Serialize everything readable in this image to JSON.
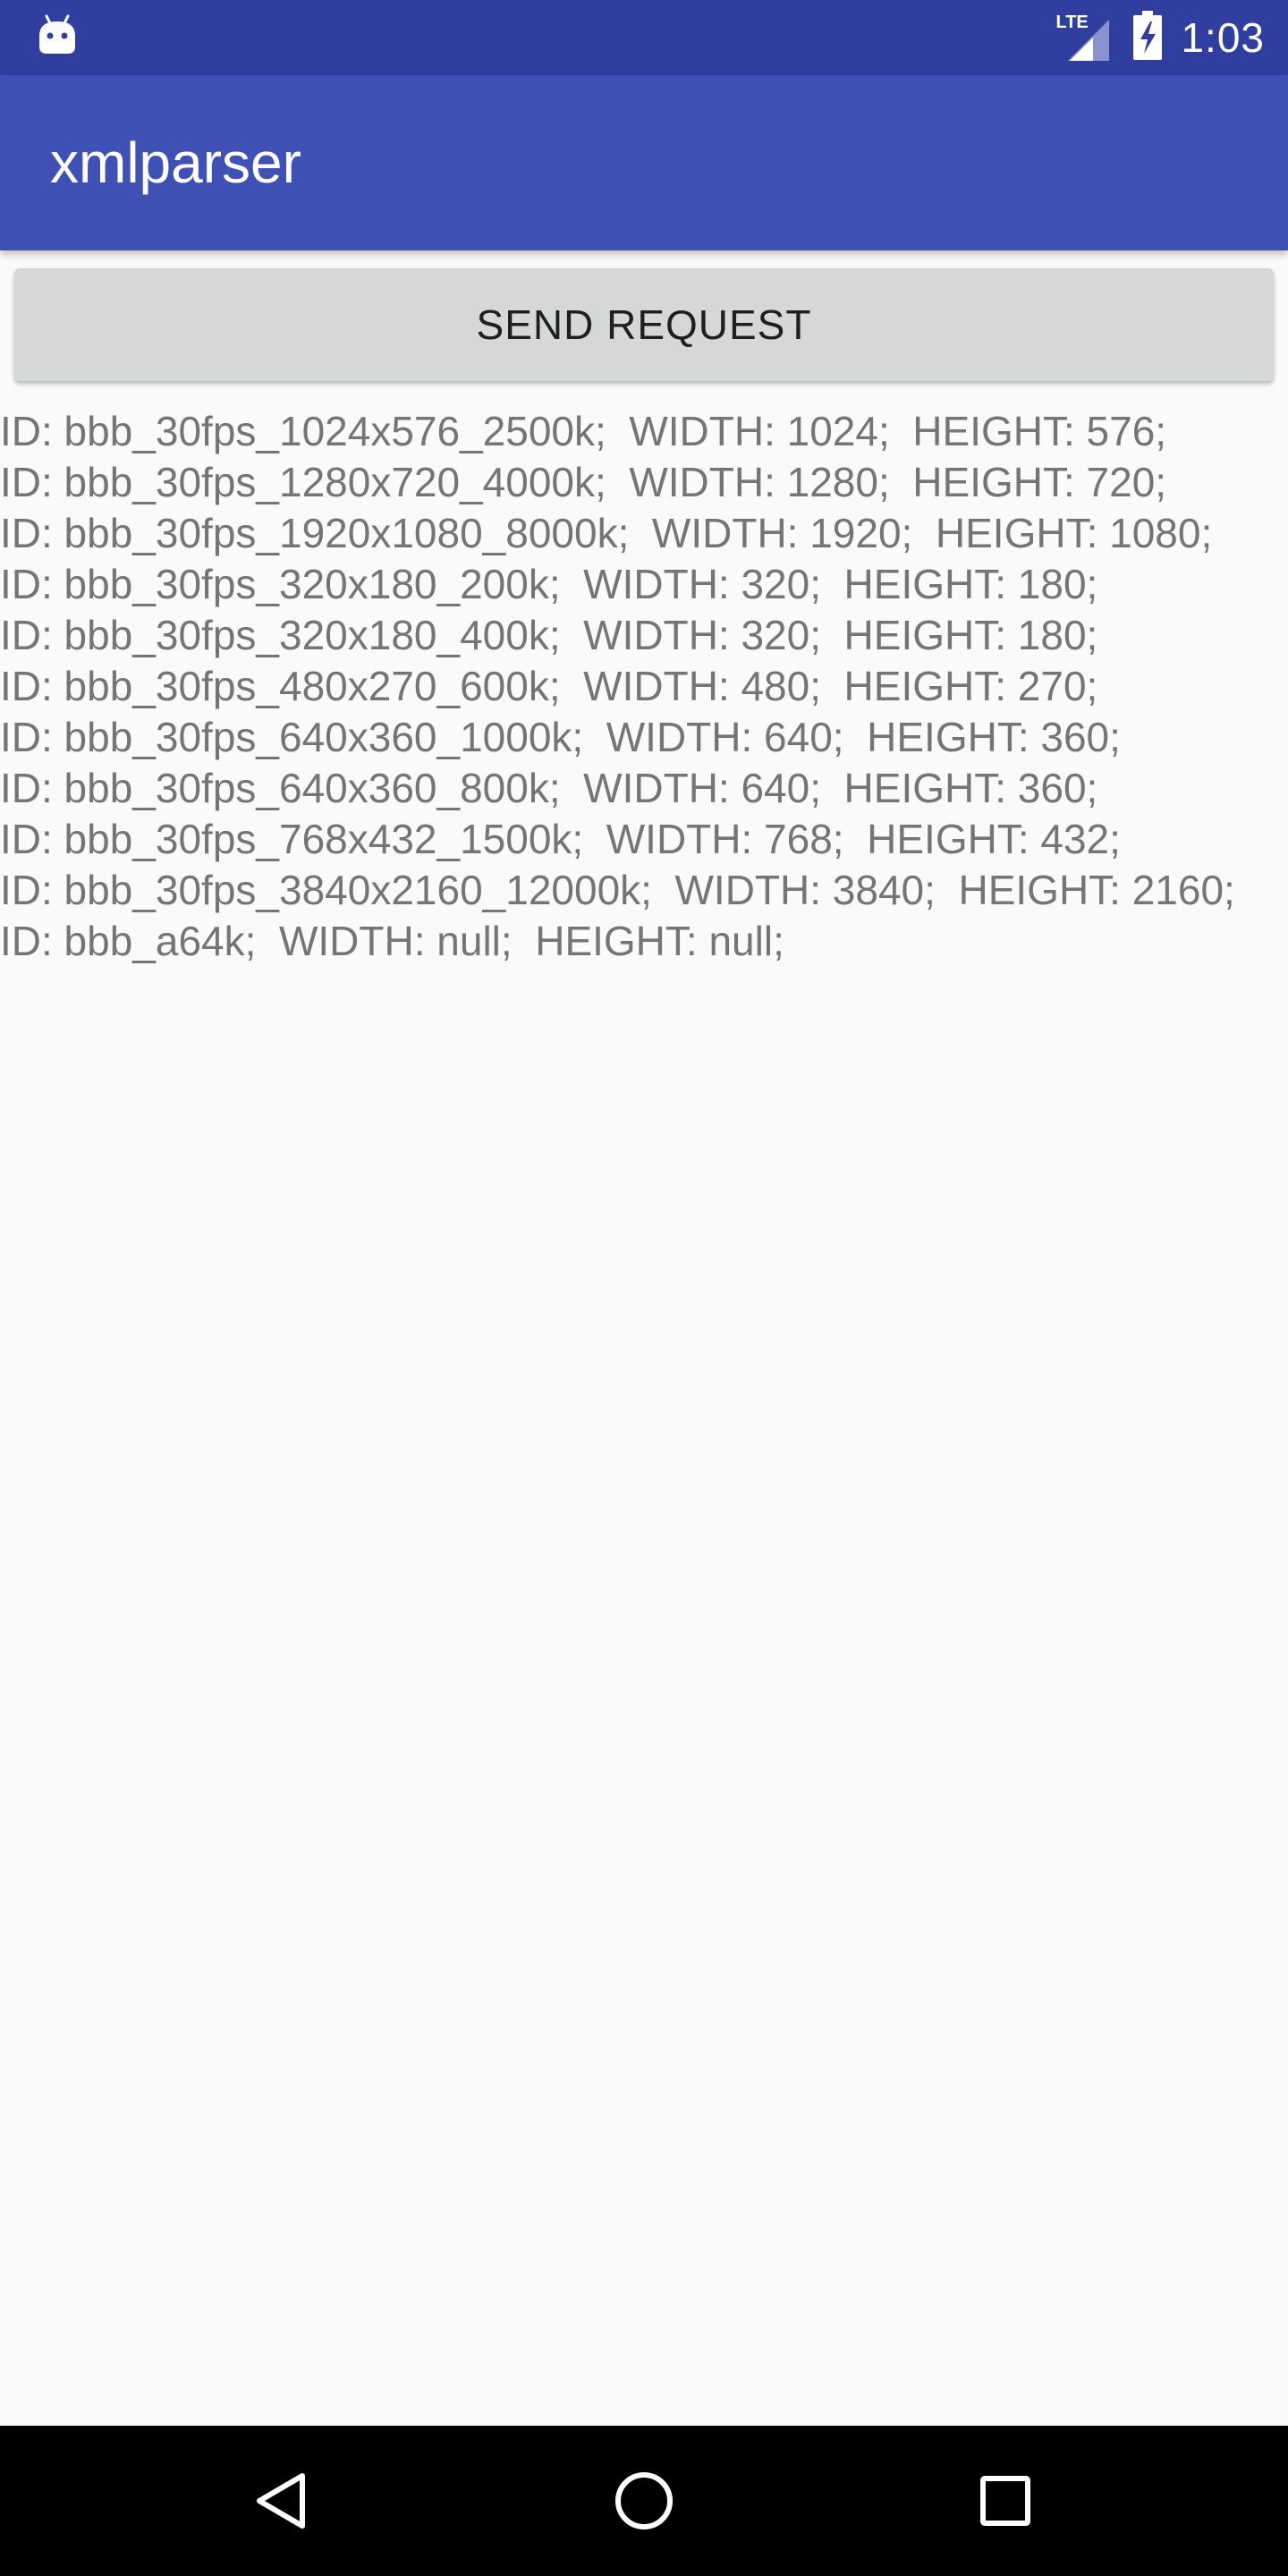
{
  "status_bar": {
    "time": "1:03",
    "network_label": "LTE",
    "left_icon": "android-robot-icon",
    "signal_icon": "cell-signal-icon",
    "battery_icon": "battery-charging-icon"
  },
  "app_bar": {
    "title": "xmlparser"
  },
  "actions": {
    "send_request_label": "SEND REQUEST"
  },
  "results": [
    "ID: bbb_30fps_1024x576_2500k;  WIDTH: 1024;  HEIGHT: 576;",
    "ID: bbb_30fps_1280x720_4000k;  WIDTH: 1280;  HEIGHT: 720;",
    "ID: bbb_30fps_1920x1080_8000k;  WIDTH: 1920;  HEIGHT: 1080;",
    "ID: bbb_30fps_320x180_200k;  WIDTH: 320;  HEIGHT: 180;",
    "ID: bbb_30fps_320x180_400k;  WIDTH: 320;  HEIGHT: 180;",
    "ID: bbb_30fps_480x270_600k;  WIDTH: 480;  HEIGHT: 270;",
    "ID: bbb_30fps_640x360_1000k;  WIDTH: 640;  HEIGHT: 360;",
    "ID: bbb_30fps_640x360_800k;  WIDTH: 640;  HEIGHT: 360;",
    "ID: bbb_30fps_768x432_1500k;  WIDTH: 768;  HEIGHT: 432;",
    "ID: bbb_30fps_3840x2160_12000k;  WIDTH: 3840;  HEIGHT: 2160;",
    "ID: bbb_a64k;  WIDTH: null;  HEIGHT: null;"
  ],
  "nav_bar": {
    "back_icon": "back-triangle-icon",
    "home_icon": "home-circle-icon",
    "recents_icon": "recents-square-icon"
  },
  "colors": {
    "status_bar": "#303f9f",
    "app_bar": "#3f51b5",
    "background": "#fafafa",
    "button": "#d6d7d7",
    "result_text": "#757575"
  }
}
